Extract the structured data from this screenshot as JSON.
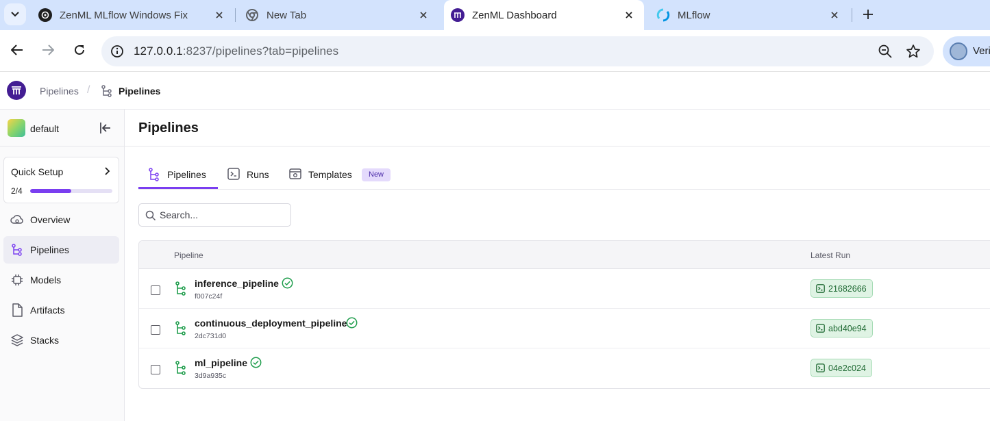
{
  "browser": {
    "tabs": [
      {
        "title": "ZenML MLflow Windows Fix",
        "icon": "openai-icon",
        "active": false
      },
      {
        "title": "New Tab",
        "icon": "chrome-icon",
        "active": false
      },
      {
        "title": "ZenML Dashboard",
        "icon": "zenml-icon",
        "active": true
      },
      {
        "title": "MLflow",
        "icon": "mlflow-icon",
        "active": false
      }
    ],
    "url_host": "127.0.0.1",
    "url_rest": ":8237/pipelines?tab=pipelines",
    "profile_name": "Veri"
  },
  "header": {
    "breadcrumb_root": "Pipelines",
    "breadcrumb_current": "Pipelines"
  },
  "sidebar": {
    "workspace": "default",
    "quick_setup": {
      "title": "Quick Setup",
      "progress_text": "2/4",
      "progress": 0.5
    },
    "items": [
      {
        "label": "Overview",
        "icon": "overview-icon"
      },
      {
        "label": "Pipelines",
        "icon": "pipelines-icon",
        "active": true
      },
      {
        "label": "Models",
        "icon": "models-icon"
      },
      {
        "label": "Artifacts",
        "icon": "artifacts-icon"
      },
      {
        "label": "Stacks",
        "icon": "stacks-icon"
      }
    ]
  },
  "main": {
    "title": "Pipelines",
    "tabs": [
      {
        "label": "Pipelines",
        "active": true
      },
      {
        "label": "Runs"
      },
      {
        "label": "Templates",
        "badge": "New"
      }
    ],
    "search_placeholder": "Search...",
    "table": {
      "columns": [
        "Pipeline",
        "Latest Run"
      ],
      "rows": [
        {
          "name": "inference_pipeline",
          "id": "f007c24f",
          "latest_run": "21682666",
          "status": "completed"
        },
        {
          "name": "continuous_deployment_pipeline",
          "id": "2dc731d0",
          "latest_run": "abd40e94",
          "status": "completed"
        },
        {
          "name": "ml_pipeline",
          "id": "3d9a935c",
          "latest_run": "04e2c024",
          "status": "completed"
        }
      ]
    }
  },
  "colors": {
    "accent": "#7a3ef0",
    "success": "#1f9d4c",
    "run_chip_bg": "#dff3e4",
    "tabstrip_bg": "#d3e3fd"
  }
}
